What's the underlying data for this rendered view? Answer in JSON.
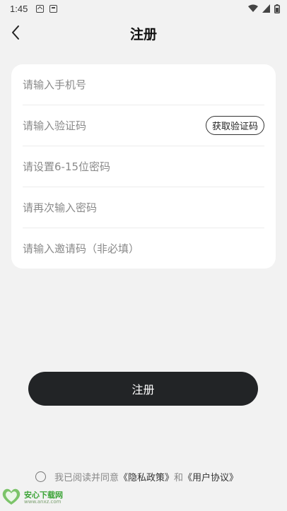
{
  "status_bar": {
    "time": "1:45",
    "notification_icons": [
      "a-box-icon",
      "image-box-icon"
    ],
    "right_icons": [
      "wifi-icon",
      "signal-icon",
      "battery-icon"
    ]
  },
  "header": {
    "title": "注册",
    "back_icon": "chevron-left-icon"
  },
  "form": {
    "phone_placeholder": "请输入手机号",
    "code_placeholder": "请输入验证码",
    "get_code_label": "获取验证码",
    "password_placeholder": "请设置6-15位密码",
    "confirm_password_placeholder": "请再次输入密码",
    "invite_placeholder": "请输入邀请码（非必填）"
  },
  "register_button_label": "注册",
  "agreement": {
    "prefix": "我已阅读并同意",
    "privacy_policy": "《隐私政策》",
    "and": "和",
    "user_agreement": "《用户协议》"
  },
  "watermark": {
    "name": "安心下载网",
    "url": "www.anxz.com"
  },
  "colors": {
    "background": "#f2f2f2",
    "card": "#ffffff",
    "primary_button": "#222426",
    "placeholder": "#8a8a8a",
    "watermark_green": "#3aa335"
  }
}
